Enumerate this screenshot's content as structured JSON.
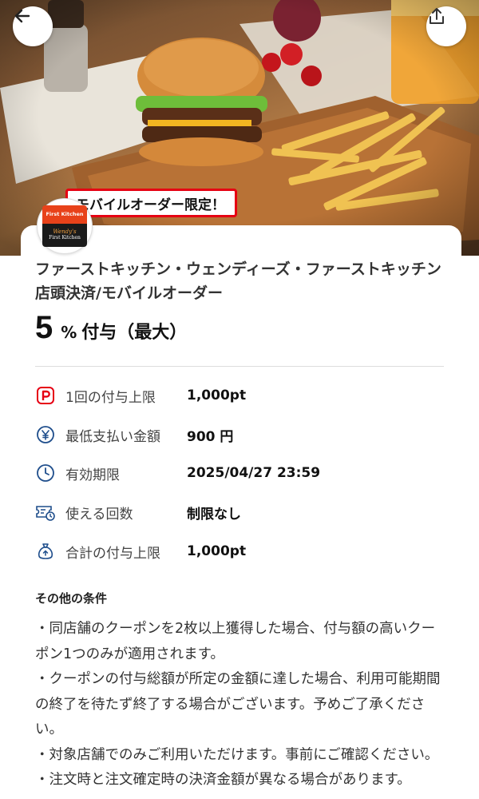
{
  "header": {
    "back_icon": "arrow-left-icon",
    "share_icon": "share-upload-icon"
  },
  "badge": "モバイルオーダー限定！",
  "logo": {
    "top_text": "First Kitchen",
    "brand_text": "Wendy's",
    "bottom_text": "First Kitchen"
  },
  "title": "ファーストキッチン・ウェンディーズ・ファーストキッチン店頭決済/モバイルオーダー",
  "rate": {
    "value": "5",
    "unit": "%",
    "text": "付与（最大）"
  },
  "info": [
    {
      "icon": "paypay-p-icon",
      "label": "1回の付与上限",
      "value": "1,000pt"
    },
    {
      "icon": "yen-circle-icon",
      "label": "最低支払い金額",
      "value": "900 円"
    },
    {
      "icon": "clock-icon",
      "label": "有効期限",
      "value": "2025/04/27 23:59"
    },
    {
      "icon": "ticket-repeat-icon",
      "label": "使える回数",
      "value": "制限なし"
    },
    {
      "icon": "money-bag-icon",
      "label": "合計の付与上限",
      "value": "1,000pt"
    }
  ],
  "conditions": {
    "title": "その他の条件",
    "items": [
      "・同店舗のクーポンを2枚以上獲得した場合、付与額の高いクーポン1つのみが適用されます。",
      "・クーポンの付与総額が所定の金額に達した場合、利用可能期間の終了を待たず終了する場合がございます。予めご了承ください。",
      "・対象店舗でのみご利用いただけます。事前にご確認ください。",
      "・注文時と注文確定時の決済金額が異なる場合があります。"
    ]
  },
  "colors": {
    "accent_red": "#e60012",
    "icon_blue": "#1f4e8c",
    "paypay_red": "#e60012"
  }
}
